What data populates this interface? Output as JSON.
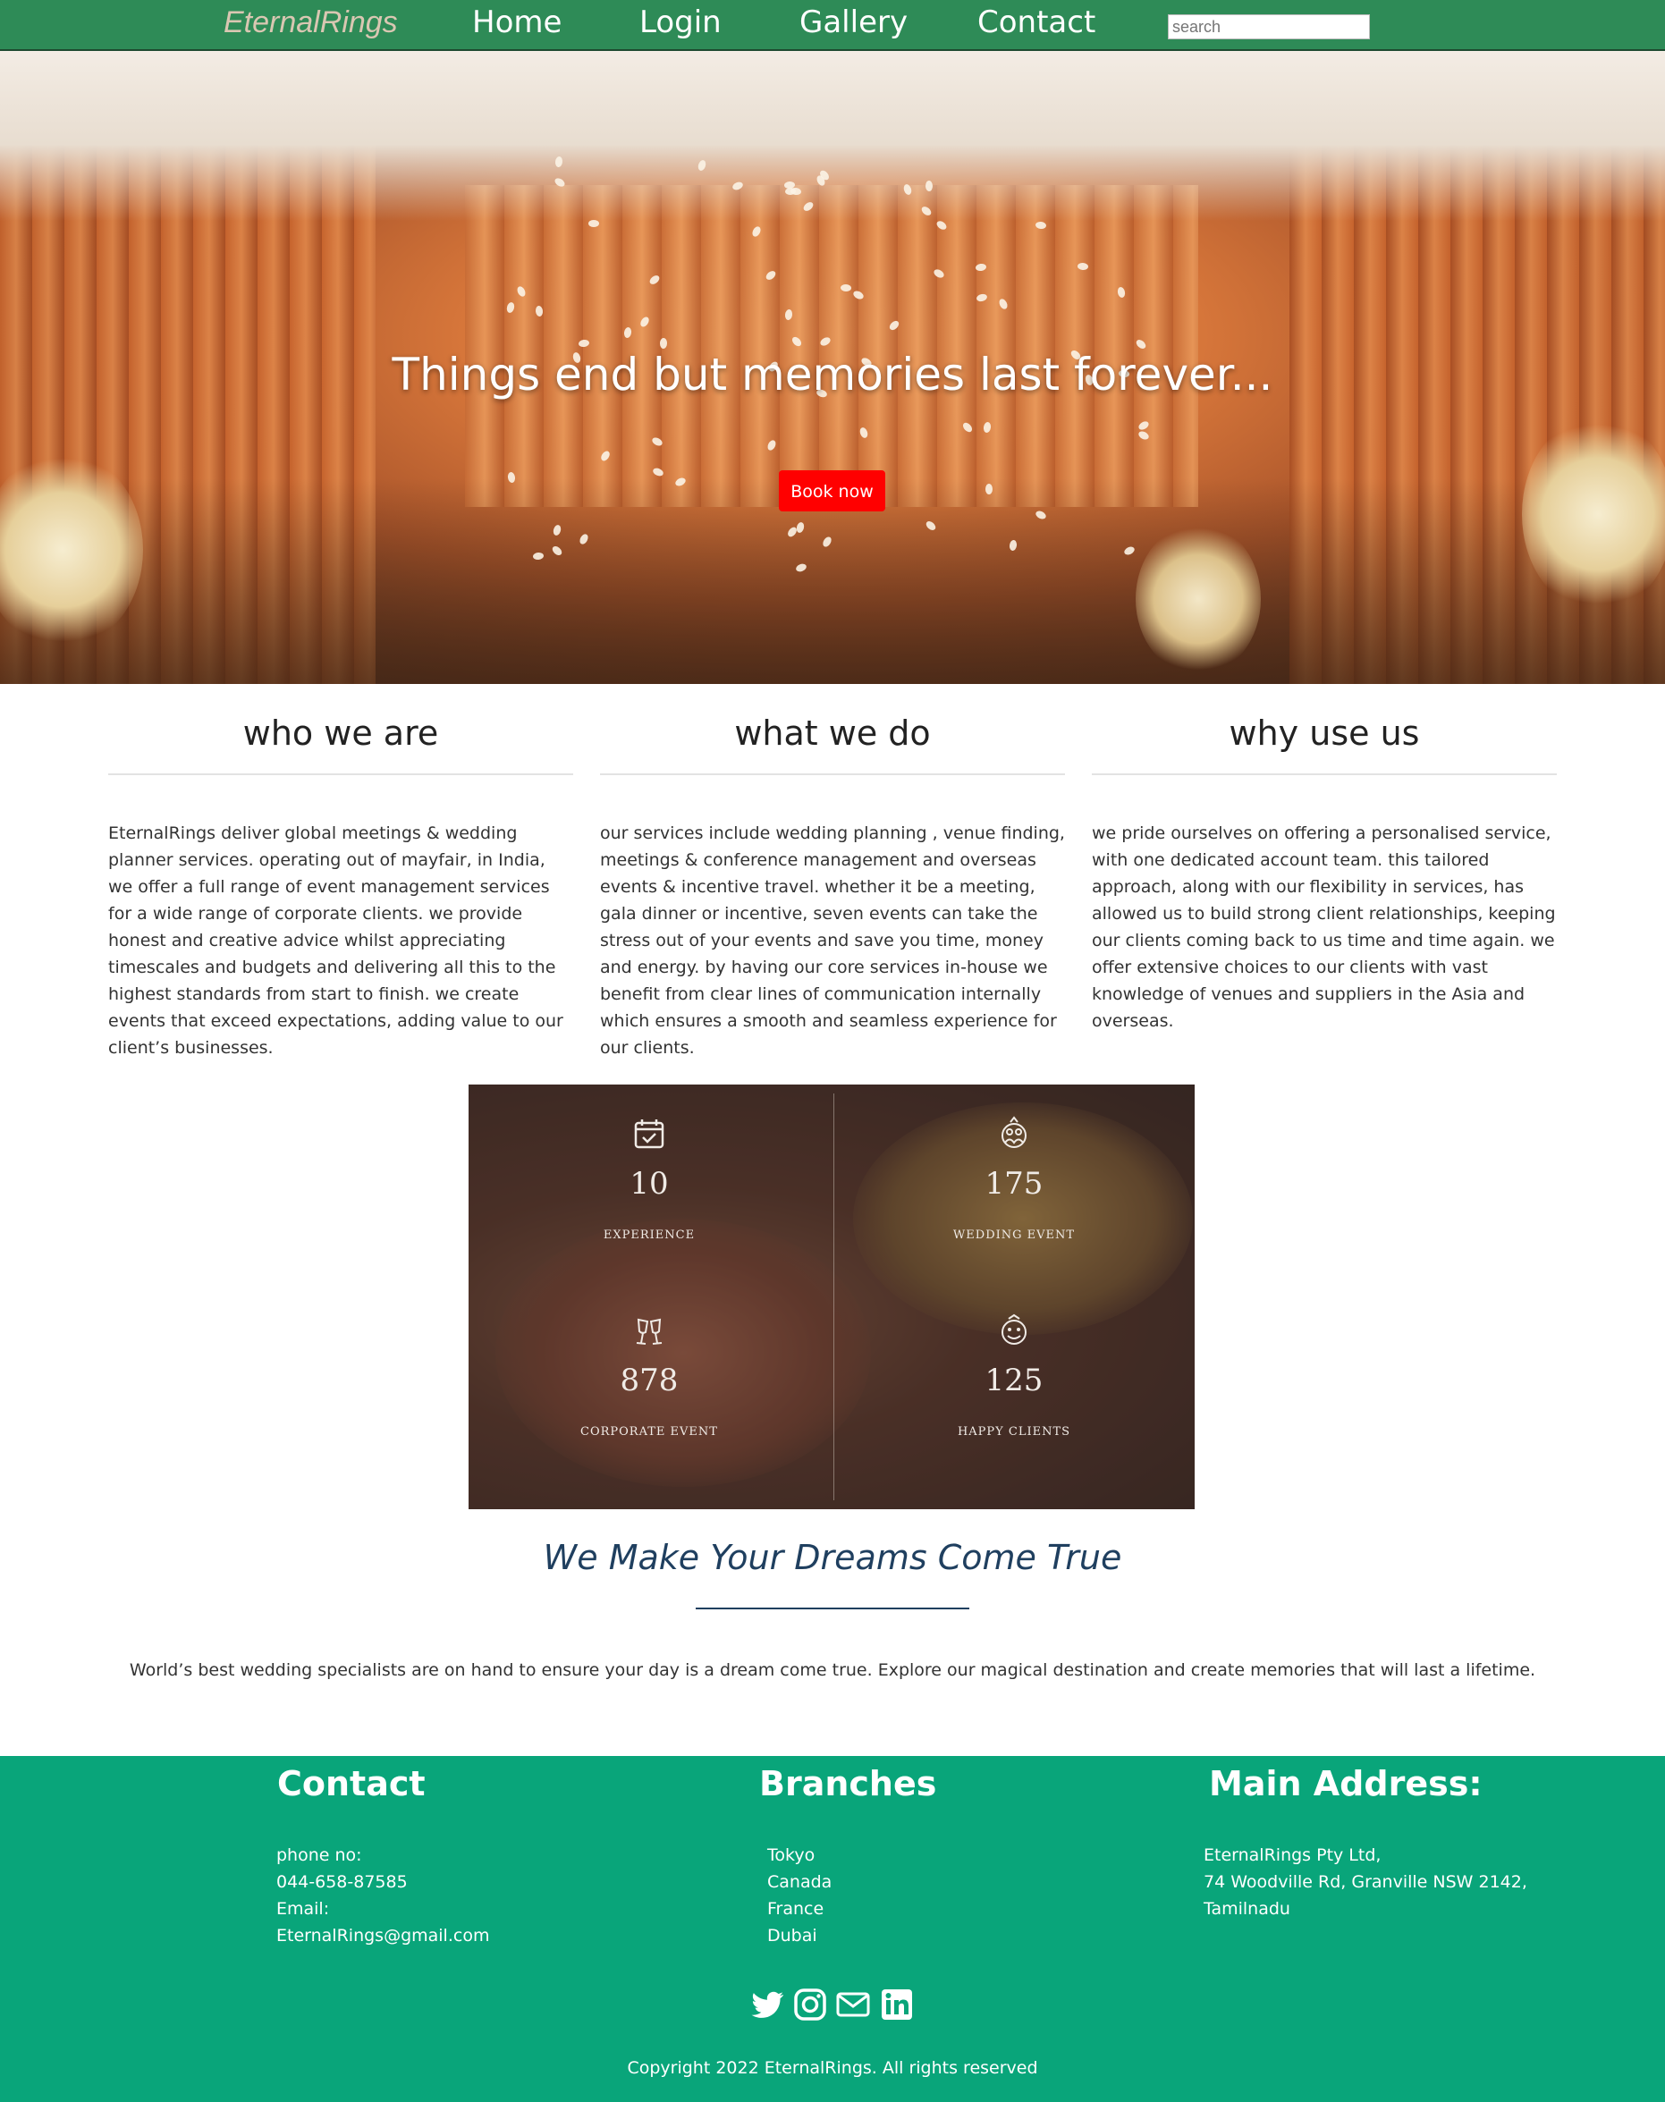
{
  "nav": {
    "brand": "EternalRings",
    "links": [
      "Home",
      "Login",
      "Gallery",
      "Contact"
    ],
    "search_placeholder": "search"
  },
  "hero": {
    "headline": "Things end but memories last forever...",
    "cta_label": "Book now"
  },
  "sections": [
    {
      "title": "who we are",
      "body": "EternalRings deliver global meetings & wedding planner services. operating out of mayfair, in India, we offer a full range of event management services for a wide range of corporate clients. we provide honest and creative advice whilst appreciating timescales and budgets and delivering all this to the highest standards from start to finish. we create events that exceed expectations, adding value to our client’s businesses."
    },
    {
      "title": "what we do",
      "body": "our services include wedding planning , venue finding, meetings & conference management and overseas events & incentive travel. whether it be a meeting, gala dinner or incentive, seven events can take the stress out of your events and save you time, money and energy. by having our core services in-house we benefit from clear lines of communication internally which ensures a smooth and seamless experience for our clients."
    },
    {
      "title": "why use us",
      "body": "we pride ourselves on offering a personalised service, with one dedicated account team. this tailored approach, along with our flexibility in services, has allowed us to build strong client relationships, keeping our clients coming back to us time and time again. we offer extensive choices to our clients with vast knowledge of venues and suppliers in the Asia and overseas."
    }
  ],
  "stats": [
    {
      "value": "10",
      "label": "EXPERIENCE",
      "icon": "calendar-check-icon"
    },
    {
      "value": "175",
      "label": "WEDDING EVENT",
      "icon": "wedding-couple-icon"
    },
    {
      "value": "878",
      "label": "CORPORATE EVENT",
      "icon": "champagne-glasses-icon"
    },
    {
      "value": "125",
      "label": "HAPPY CLIENTS",
      "icon": "happy-clients-icon"
    }
  ],
  "dreams": {
    "title": "We Make Your Dreams Come True",
    "text": "World’s best wedding specialists are on hand to ensure your day is a dream come true. Explore our magical destination and create memories that will last a lifetime."
  },
  "footer": {
    "contact": {
      "title": "Contact",
      "lines": [
        "phone no:",
        "044-658-87585",
        "Email:",
        "EternalRings@gmail.com"
      ]
    },
    "branches": {
      "title": "Branches",
      "lines": [
        "Tokyo",
        "Canada",
        "France",
        "Dubai"
      ]
    },
    "address": {
      "title": "Main Address:",
      "lines": [
        "EternalRings Pty Ltd,",
        "74 Woodville Rd, Granville NSW 2142,",
        "Tamilnadu"
      ]
    },
    "social_icons": [
      "twitter-icon",
      "instagram-icon",
      "mail-icon",
      "linkedin-icon"
    ],
    "copyright": "Copyright 2022 EternalRings. All rights reserved"
  },
  "colors": {
    "nav_bg": "#2e8b57",
    "footer_bg": "#09a57a",
    "cta_bg": "#ff0000",
    "dreams_title": "#1f3f5f"
  }
}
